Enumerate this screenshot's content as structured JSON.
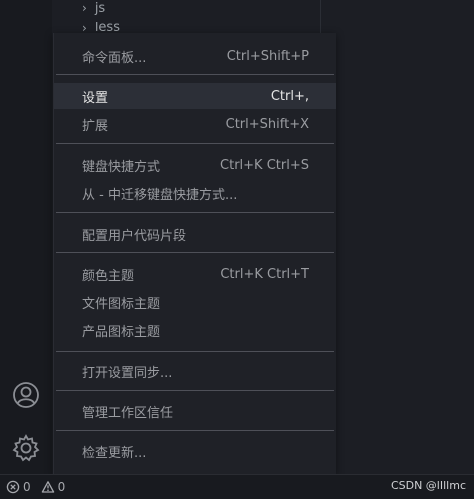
{
  "explorer": {
    "items": [
      {
        "label": "js"
      },
      {
        "label": "less"
      }
    ]
  },
  "activitybar": {
    "icons": [
      "account-icon",
      "settings-gear-icon"
    ]
  },
  "menu": {
    "items": [
      {
        "label": "命令面板...",
        "shortcut": "Ctrl+Shift+P"
      },
      {
        "label": "设置",
        "shortcut": "Ctrl+,"
      },
      {
        "label": "扩展",
        "shortcut": "Ctrl+Shift+X"
      },
      {
        "label": "键盘快捷方式",
        "shortcut": "Ctrl+K Ctrl+S"
      },
      {
        "label": "从 - 中迁移键盘快捷方式...",
        "shortcut": ""
      },
      {
        "label": "配置用户代码片段",
        "shortcut": ""
      },
      {
        "label": "颜色主题",
        "shortcut": "Ctrl+K Ctrl+T"
      },
      {
        "label": "文件图标主题",
        "shortcut": ""
      },
      {
        "label": "产品图标主题",
        "shortcut": ""
      },
      {
        "label": "打开设置同步...",
        "shortcut": ""
      },
      {
        "label": "管理工作区信任",
        "shortcut": ""
      },
      {
        "label": "检查更新...",
        "shortcut": ""
      }
    ]
  },
  "statusbar": {
    "errors": "0",
    "warnings": "0",
    "watermark": "CSDN @lIllmc"
  },
  "colors": {
    "background": "#181a1f",
    "menu_background": "#1f2127",
    "menu_active": "#2c2f37",
    "separator": "#4e5058"
  }
}
